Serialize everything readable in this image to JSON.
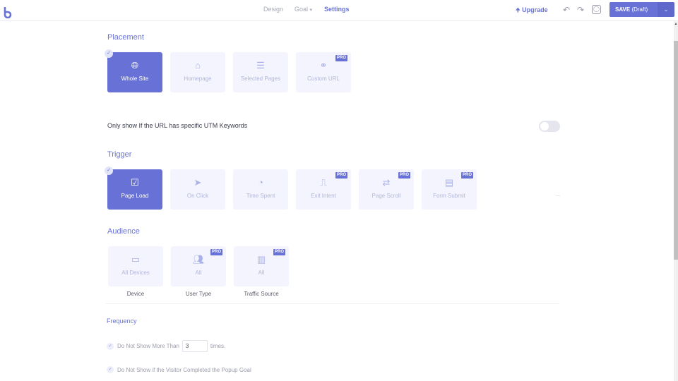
{
  "header": {
    "logo": "b",
    "tabs": [
      {
        "label": "Design",
        "active": false
      },
      {
        "label": "Goal",
        "active": false,
        "has_dropdown": true
      },
      {
        "label": "Settings",
        "active": true
      }
    ],
    "upgrade_label": "Upgrade",
    "upgrade_icon": "arrow-up",
    "undo_icon": "↶",
    "redo_icon": "↷",
    "preview_icon": "◙",
    "save_label": "SAVE",
    "save_status": "(Draft)",
    "save_dropdown_icon": "⌄"
  },
  "colors": {
    "accent": "#6872d6",
    "card_bg": "#f3f4fd",
    "card_text": "#b3b7d8"
  },
  "placement": {
    "title": "Placement",
    "options": [
      {
        "label": "Whole Site",
        "icon": "globe-icon",
        "glyph": "🌐︎",
        "selected": true,
        "pro": false
      },
      {
        "label": "Homepage",
        "icon": "home-icon",
        "glyph": "⌂",
        "selected": false,
        "pro": false
      },
      {
        "label": "Selected Pages",
        "icon": "checklist-icon",
        "glyph": "☰",
        "selected": false,
        "pro": false
      },
      {
        "label": "Custom URL",
        "icon": "link-icon",
        "glyph": "⚭",
        "selected": false,
        "pro": true
      }
    ]
  },
  "utm": {
    "label": "Only show If the URL has specific UTM Keywords",
    "enabled": false
  },
  "trigger": {
    "title": "Trigger",
    "options": [
      {
        "label": "Page Load",
        "icon": "checkbox-icon",
        "glyph": "☑",
        "selected": true,
        "pro": false
      },
      {
        "label": "On Click",
        "icon": "cursor-icon",
        "glyph": "➤",
        "selected": false,
        "pro": false
      },
      {
        "label": "Time Spent",
        "icon": "user-clock-icon",
        "glyph": "◔",
        "selected": false,
        "pro": false
      },
      {
        "label": "Exit Intent",
        "icon": "door-exit-icon",
        "glyph": "⎍",
        "selected": false,
        "pro": true
      },
      {
        "label": "Page Scroll",
        "icon": "arrows-exchange-icon",
        "glyph": "⇄",
        "selected": false,
        "pro": true
      },
      {
        "label": "Form Submit",
        "icon": "form-list-icon",
        "glyph": "▤",
        "selected": false,
        "pro": true
      }
    ]
  },
  "audience": {
    "title": "Audience",
    "options": [
      {
        "label": "All Devices",
        "caption": "Device",
        "icon": "monitor-icon",
        "glyph": "▭",
        "pro": false
      },
      {
        "label": "All",
        "caption": "User Type",
        "icon": "users-icon",
        "glyph": "👥︎",
        "pro": true
      },
      {
        "label": "All",
        "caption": "Traffic Source",
        "icon": "bar-chart-icon",
        "glyph": "▥",
        "pro": true
      }
    ]
  },
  "pro_badge": "PRO",
  "check_glyph": "✓",
  "frequency": {
    "title": "Frequency",
    "max_show_prefix": "Do Not Show More Than",
    "max_show_value": "3",
    "max_show_suffix": "times.",
    "goal_completed_label": "Do Not Show if the Visitor Completed the Popup Goal"
  }
}
